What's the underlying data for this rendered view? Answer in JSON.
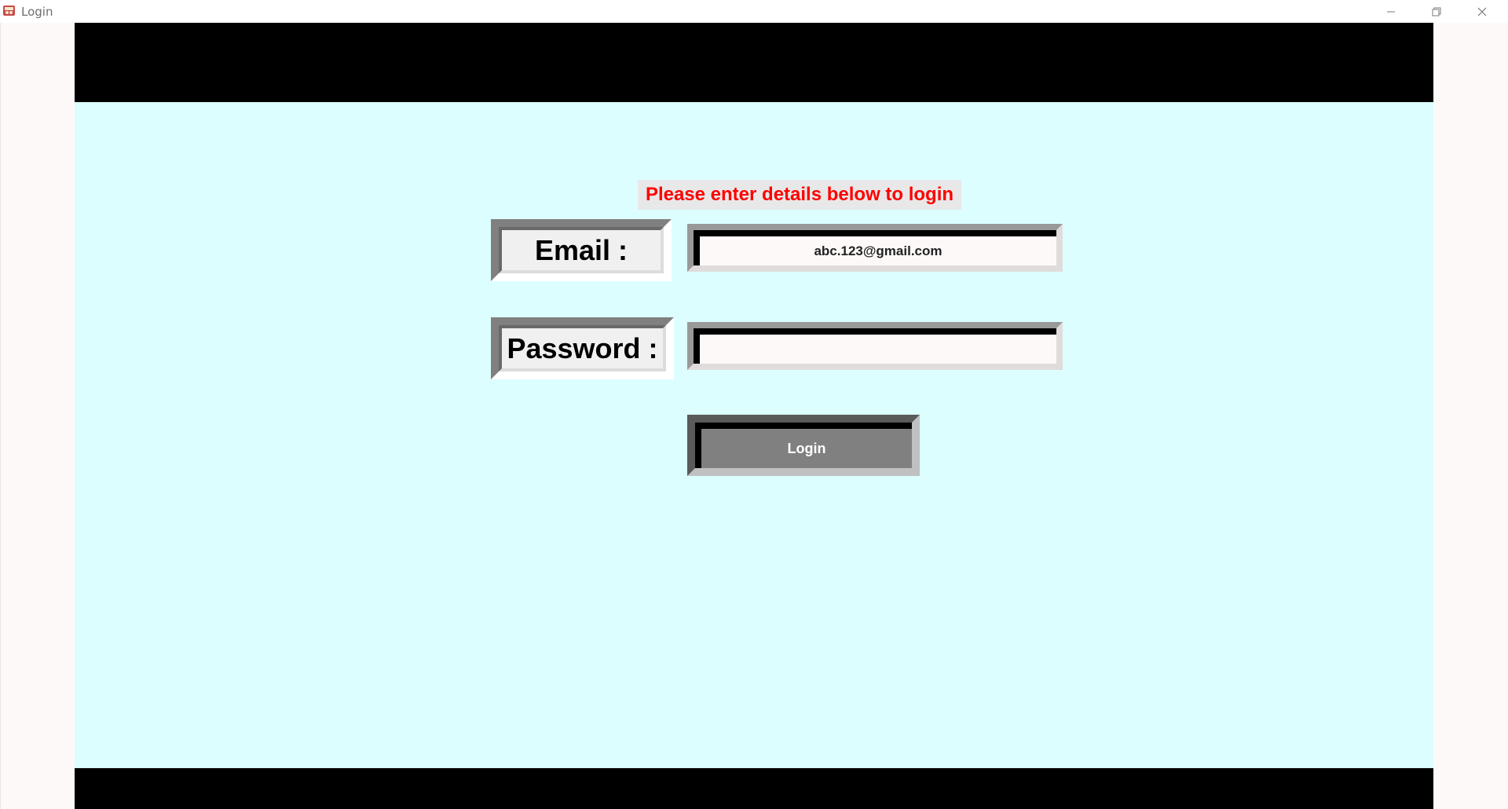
{
  "window": {
    "title": "Login",
    "controls": {
      "minimize_icon": "minimize-icon",
      "maximize_icon": "restore-icon",
      "close_icon": "close-icon"
    }
  },
  "form": {
    "heading": "Please enter details below to login",
    "email_label": "Email :",
    "email_value": "abc.123@gmail.com",
    "password_label": "Password :",
    "password_value": "",
    "login_button": "Login"
  },
  "colors": {
    "background": "#dcfeff",
    "band": "#000000",
    "heading_text": "#ff0000",
    "button": "#808080"
  }
}
